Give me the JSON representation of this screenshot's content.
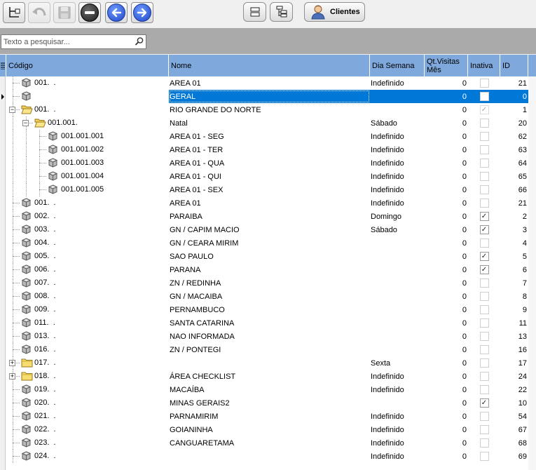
{
  "toolbar": {
    "buttons": [
      {
        "name": "tree-insert-icon",
        "enabled": true
      },
      {
        "name": "undo-icon",
        "enabled": false
      },
      {
        "name": "save-icon",
        "enabled": false
      },
      {
        "name": "delete-icon",
        "enabled": true
      },
      {
        "name": "arrow-left-icon",
        "enabled": true
      },
      {
        "name": "arrow-right-icon",
        "enabled": true
      },
      {
        "name": "collapse-icon",
        "enabled": true
      },
      {
        "name": "expand-tree-icon",
        "enabled": true
      }
    ],
    "clientes_label": "Clientes"
  },
  "search": {
    "placeholder": "Texto a pesquisar..."
  },
  "columns": {
    "codigo": "Código",
    "nome": "Nome",
    "dia_semana": "Dia Semana",
    "qt_visitas_line1": "Qt.Visitas",
    "qt_visitas_line2": "Mês",
    "inativa": "Inativa",
    "id": "ID"
  },
  "rows": [
    {
      "codigo": "001.  .",
      "nome": "AREA 01",
      "dia": "Indefinido",
      "qt": "0",
      "inativa": "unchecked",
      "id": "21",
      "level": 0,
      "icon": "cube",
      "expander": ""
    },
    {
      "codigo": "",
      "nome": "GERAL",
      "dia": "",
      "qt": "0",
      "inativa": "unchecked",
      "id": "0",
      "level": 0,
      "icon": "cube",
      "expander": "",
      "selected": true
    },
    {
      "codigo": "001.  .",
      "nome": "RIO GRANDE DO NORTE",
      "dia": "",
      "qt": "0",
      "inativa": "grey",
      "id": "1",
      "level": 0,
      "icon": "folder-open",
      "expander": "minus"
    },
    {
      "codigo": "001.001.",
      "nome": "Natal",
      "dia": "Sábado",
      "qt": "0",
      "inativa": "unchecked",
      "id": "20",
      "level": 1,
      "icon": "folder-open",
      "expander": "minus"
    },
    {
      "codigo": "001.001.001",
      "nome": "AREA 01 - SEG",
      "dia": "Indefinido",
      "qt": "0",
      "inativa": "unchecked",
      "id": "62",
      "level": 2,
      "icon": "cube",
      "expander": ""
    },
    {
      "codigo": "001.001.002",
      "nome": "AREA 01 - TER",
      "dia": "Indefinido",
      "qt": "0",
      "inativa": "unchecked",
      "id": "63",
      "level": 2,
      "icon": "cube",
      "expander": ""
    },
    {
      "codigo": "001.001.003",
      "nome": "AREA 01 - QUA",
      "dia": "Indefinido",
      "qt": "0",
      "inativa": "unchecked",
      "id": "64",
      "level": 2,
      "icon": "cube",
      "expander": ""
    },
    {
      "codigo": "001.001.004",
      "nome": "AREA 01 - QUI",
      "dia": "Indefinido",
      "qt": "0",
      "inativa": "unchecked",
      "id": "65",
      "level": 2,
      "icon": "cube",
      "expander": ""
    },
    {
      "codigo": "001.001.005",
      "nome": "AREA 01 - SEX",
      "dia": "Indefinido",
      "qt": "0",
      "inativa": "unchecked",
      "id": "66",
      "level": 2,
      "icon": "cube",
      "expander": ""
    },
    {
      "codigo": "001.  .",
      "nome": "AREA 01",
      "dia": "Indefinido",
      "qt": "0",
      "inativa": "unchecked",
      "id": "21",
      "level": 0,
      "icon": "cube",
      "expander": ""
    },
    {
      "codigo": "002.  .",
      "nome": "PARAIBA",
      "dia": "Domingo",
      "qt": "0",
      "inativa": "checked",
      "id": "2",
      "level": 0,
      "icon": "cube",
      "expander": ""
    },
    {
      "codigo": "003.  .",
      "nome": "GN / CAPIM MACIO",
      "dia": "Sábado",
      "qt": "0",
      "inativa": "checked",
      "id": "3",
      "level": 0,
      "icon": "cube",
      "expander": ""
    },
    {
      "codigo": "004.  .",
      "nome": "GN / CEARA MIRIM",
      "dia": "",
      "qt": "0",
      "inativa": "unchecked",
      "id": "4",
      "level": 0,
      "icon": "cube",
      "expander": ""
    },
    {
      "codigo": "005.  .",
      "nome": "SAO PAULO",
      "dia": "",
      "qt": "0",
      "inativa": "checked",
      "id": "5",
      "level": 0,
      "icon": "cube",
      "expander": ""
    },
    {
      "codigo": "006.  .",
      "nome": "PARANA",
      "dia": "",
      "qt": "0",
      "inativa": "checked",
      "id": "6",
      "level": 0,
      "icon": "cube",
      "expander": ""
    },
    {
      "codigo": "007.  .",
      "nome": "ZN / REDINHA",
      "dia": "",
      "qt": "0",
      "inativa": "unchecked",
      "id": "7",
      "level": 0,
      "icon": "cube",
      "expander": ""
    },
    {
      "codigo": "008.  .",
      "nome": "GN / MACAIBA",
      "dia": "",
      "qt": "0",
      "inativa": "unchecked",
      "id": "8",
      "level": 0,
      "icon": "cube",
      "expander": ""
    },
    {
      "codigo": "009.  .",
      "nome": "PERNAMBUCO",
      "dia": "",
      "qt": "0",
      "inativa": "unchecked",
      "id": "9",
      "level": 0,
      "icon": "cube",
      "expander": ""
    },
    {
      "codigo": "011.  .",
      "nome": "SANTA CATARINA",
      "dia": "",
      "qt": "0",
      "inativa": "unchecked",
      "id": "11",
      "level": 0,
      "icon": "cube",
      "expander": ""
    },
    {
      "codigo": "013.  .",
      "nome": "NAO INFORMADA",
      "dia": "",
      "qt": "0",
      "inativa": "unchecked",
      "id": "13",
      "level": 0,
      "icon": "cube",
      "expander": ""
    },
    {
      "codigo": "016.  .",
      "nome": "ZN / PONTEGI",
      "dia": "",
      "qt": "0",
      "inativa": "unchecked",
      "id": "16",
      "level": 0,
      "icon": "cube",
      "expander": ""
    },
    {
      "codigo": "017.  .",
      "nome": "",
      "dia": "Sexta",
      "qt": "0",
      "inativa": "unchecked",
      "id": "17",
      "level": 0,
      "icon": "folder-closed",
      "expander": "plus"
    },
    {
      "codigo": "018.  .",
      "nome": "ÁREA CHECKLIST",
      "dia": "Indefinido",
      "qt": "0",
      "inativa": "unchecked",
      "id": "24",
      "level": 0,
      "icon": "folder-closed",
      "expander": "plus"
    },
    {
      "codigo": "019.  .",
      "nome": "MACAÍBA",
      "dia": "Indefinido",
      "qt": "0",
      "inativa": "unchecked",
      "id": "22",
      "level": 0,
      "icon": "cube",
      "expander": ""
    },
    {
      "codigo": "020.  .",
      "nome": "MINAS GERAIS2",
      "dia": "",
      "qt": "0",
      "inativa": "checked",
      "id": "10",
      "level": 0,
      "icon": "cube",
      "expander": ""
    },
    {
      "codigo": "021.  .",
      "nome": "PARNAMIRIM",
      "dia": "Indefinido",
      "qt": "0",
      "inativa": "unchecked",
      "id": "54",
      "level": 0,
      "icon": "cube",
      "expander": ""
    },
    {
      "codigo": "022.  .",
      "nome": "GOIANINHA",
      "dia": "Indefinido",
      "qt": "0",
      "inativa": "unchecked",
      "id": "67",
      "level": 0,
      "icon": "cube",
      "expander": ""
    },
    {
      "codigo": "023.  .",
      "nome": "CANGUARETAMA",
      "dia": "Indefinido",
      "qt": "0",
      "inativa": "unchecked",
      "id": "68",
      "level": 0,
      "icon": "cube",
      "expander": ""
    },
    {
      "codigo": "024.  .",
      "nome": "",
      "dia": "Indefinido",
      "qt": "0",
      "inativa": "unchecked",
      "id": "69",
      "level": 0,
      "icon": "cube",
      "expander": ""
    }
  ],
  "colors": {
    "header_bg": "#7fa9dc",
    "selection": "#0078d7",
    "search_strip": "#aaaaaa"
  }
}
